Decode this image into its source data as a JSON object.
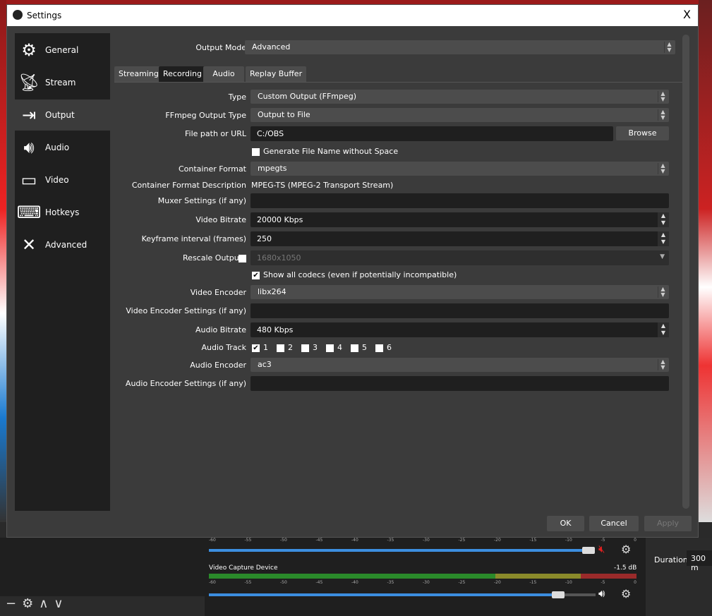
{
  "window": {
    "title": "Settings",
    "close": "X"
  },
  "background": {
    "duration_label": "Duration",
    "duration_value": "300 m",
    "mixer_source": "Video Capture Device",
    "mixer_db": "-1.5 dB",
    "meter_ticks": [
      "-60",
      "-55",
      "-50",
      "-45",
      "-40",
      "-35",
      "-30",
      "-25",
      "-20",
      "-15",
      "-10",
      "-5",
      "0"
    ],
    "colors": {
      "volume": "#3c8ee0",
      "muted": "#e02020"
    }
  },
  "sidebar": {
    "items": [
      {
        "label": "General",
        "icon": "gear-icon"
      },
      {
        "label": "Stream",
        "icon": "antenna-icon"
      },
      {
        "label": "Output",
        "icon": "monitor-arrow-icon",
        "selected": true
      },
      {
        "label": "Audio",
        "icon": "speaker-icon"
      },
      {
        "label": "Video",
        "icon": "monitor-icon"
      },
      {
        "label": "Hotkeys",
        "icon": "keyboard-icon"
      },
      {
        "label": "Advanced",
        "icon": "tools-icon"
      }
    ]
  },
  "output_mode": {
    "label": "Output Mode",
    "value": "Advanced"
  },
  "tabs": [
    {
      "label": "Streaming"
    },
    {
      "label": "Recording",
      "selected": true
    },
    {
      "label": "Audio"
    },
    {
      "label": "Replay Buffer"
    }
  ],
  "form": {
    "type": {
      "label": "Type",
      "value": "Custom Output (FFmpeg)"
    },
    "ffmpeg_type": {
      "label": "FFmpeg Output Type",
      "value": "Output to File"
    },
    "file_path": {
      "label": "File path or URL",
      "value": "C:/OBS",
      "browse": "Browse"
    },
    "gen_name": {
      "label": "Generate File Name without Space",
      "checked": false
    },
    "container": {
      "label": "Container Format",
      "value": "mpegts"
    },
    "container_desc": {
      "label": "Container Format Description",
      "value": "MPEG-TS (MPEG-2 Transport Stream)"
    },
    "muxer": {
      "label": "Muxer Settings (if any)",
      "value": ""
    },
    "video_bitrate": {
      "label": "Video Bitrate",
      "value": "20000 Kbps"
    },
    "keyframe": {
      "label": "Keyframe interval (frames)",
      "value": "250"
    },
    "rescale": {
      "label": "Rescale Output",
      "checked": false,
      "value": "1680x1050"
    },
    "show_codecs": {
      "label": "Show all codecs (even if potentially incompatible)",
      "checked": true
    },
    "video_encoder": {
      "label": "Video Encoder",
      "value": "libx264"
    },
    "video_enc_settings": {
      "label": "Video Encoder Settings (if any)",
      "value": ""
    },
    "audio_bitrate": {
      "label": "Audio Bitrate",
      "value": "480 Kbps"
    },
    "audio_track": {
      "label": "Audio Track",
      "tracks": [
        {
          "n": "1",
          "checked": true
        },
        {
          "n": "2",
          "checked": false
        },
        {
          "n": "3",
          "checked": false
        },
        {
          "n": "4",
          "checked": false
        },
        {
          "n": "5",
          "checked": false
        },
        {
          "n": "6",
          "checked": false
        }
      ]
    },
    "audio_encoder": {
      "label": "Audio Encoder",
      "value": "ac3"
    },
    "audio_enc_settings": {
      "label": "Audio Encoder Settings (if any)",
      "value": ""
    }
  },
  "buttons": {
    "ok": "OK",
    "cancel": "Cancel",
    "apply": "Apply"
  }
}
